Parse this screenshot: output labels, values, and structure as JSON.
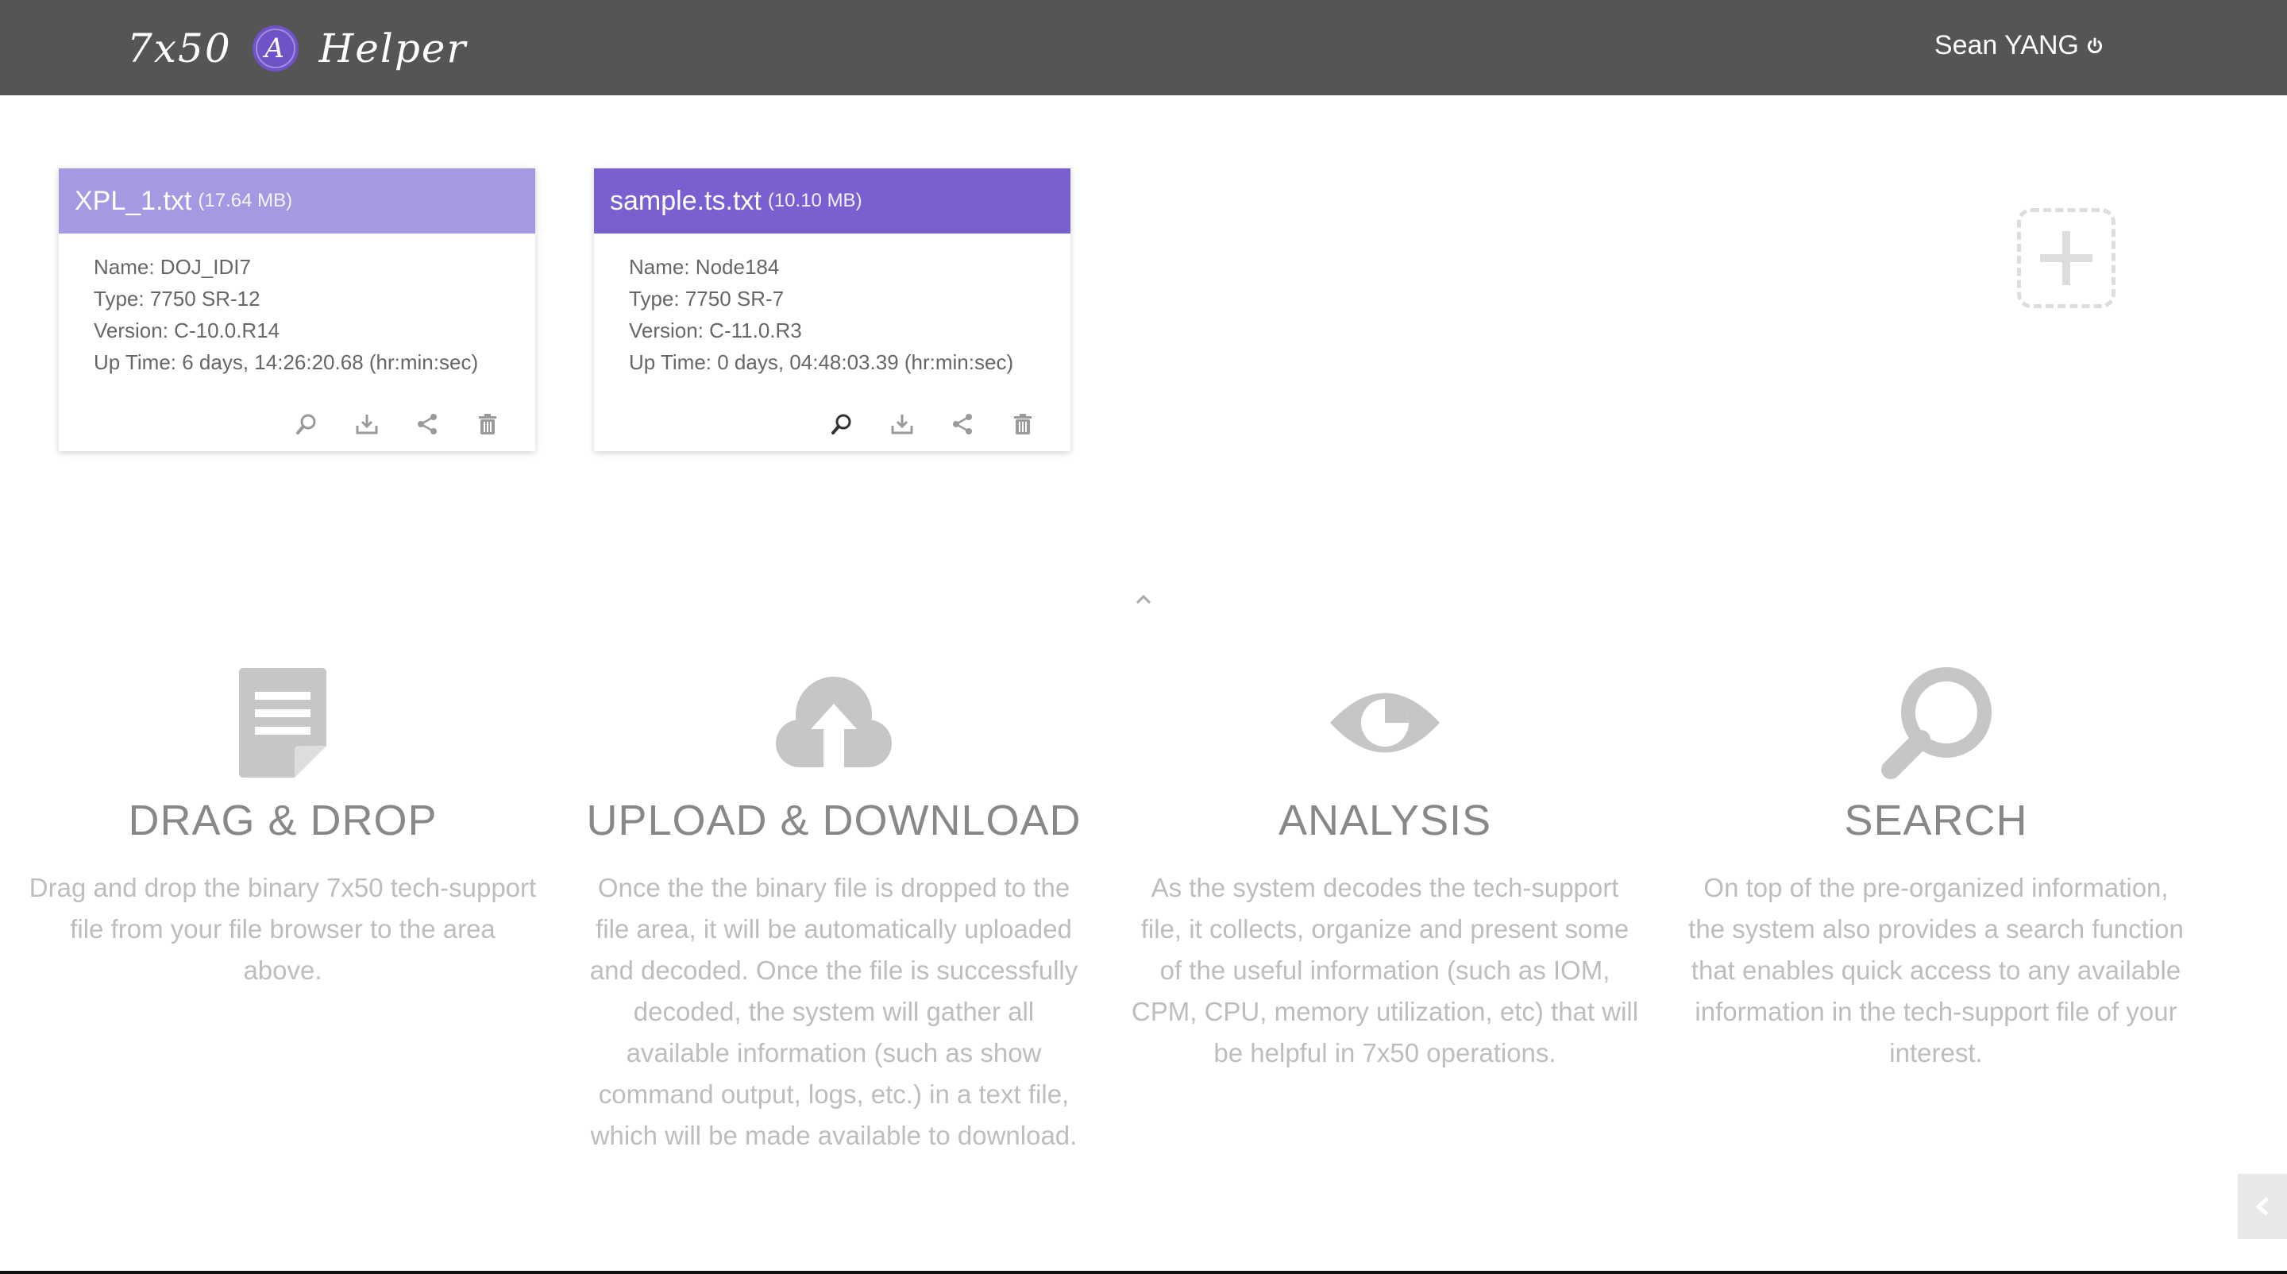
{
  "header": {
    "logo_left": "7x50",
    "logo_badge": "A",
    "logo_right": "Helper",
    "user_name": "Sean YANG",
    "power_icon": "power-icon"
  },
  "colors": {
    "header_bg": "#555555",
    "card_light_header": "#a798e3",
    "card_dark_header": "#7a5fd1",
    "feature_title": "#888888",
    "feature_text": "#bdbdbd"
  },
  "cards": [
    {
      "filename": "XPL_1.txt",
      "size": "(17.64 MB)",
      "name": "Name: DOJ_IDI7",
      "type": "Type: 7750 SR-12",
      "version": "Version: C-10.0.R14",
      "uptime": "Up Time: 6 days, 14:26:20.68 (hr:min:sec)"
    },
    {
      "filename": "sample.ts.txt",
      "size": "(10.10 MB)",
      "name": "Name: Node184",
      "type": "Type: 7750 SR-7",
      "version": "Version: C-11.0.R3",
      "uptime": "Up Time: 0 days, 04:48:03.39 (hr:min:sec)"
    }
  ],
  "features": [
    {
      "icon": "document-icon",
      "title": "DRAG & DROP",
      "text": "Drag and drop the binary 7x50 tech-support file from your file browser to the area above."
    },
    {
      "icon": "cloud-upload-icon",
      "title": "UPLOAD & DOWNLOAD",
      "text": "Once the the binary file is dropped to the file area, it will be automatically uploaded and decoded. Once the file is successfully decoded, the system will gather all available information (such as show command output, logs, etc.) in a text file, which will be made available to download."
    },
    {
      "icon": "eye-icon",
      "title": "ANALYSIS",
      "text": "As the system decodes the tech-support file, it collects, organize and present some of the useful information (such as IOM, CPM, CPU, memory utilization, etc) that will be helpful in 7x50 operations."
    },
    {
      "icon": "search-icon",
      "title": "SEARCH",
      "text": "On top of the pre-organized information, the system also provides a search function that enables quick access to any available information in the tech-support file of your interest."
    }
  ]
}
